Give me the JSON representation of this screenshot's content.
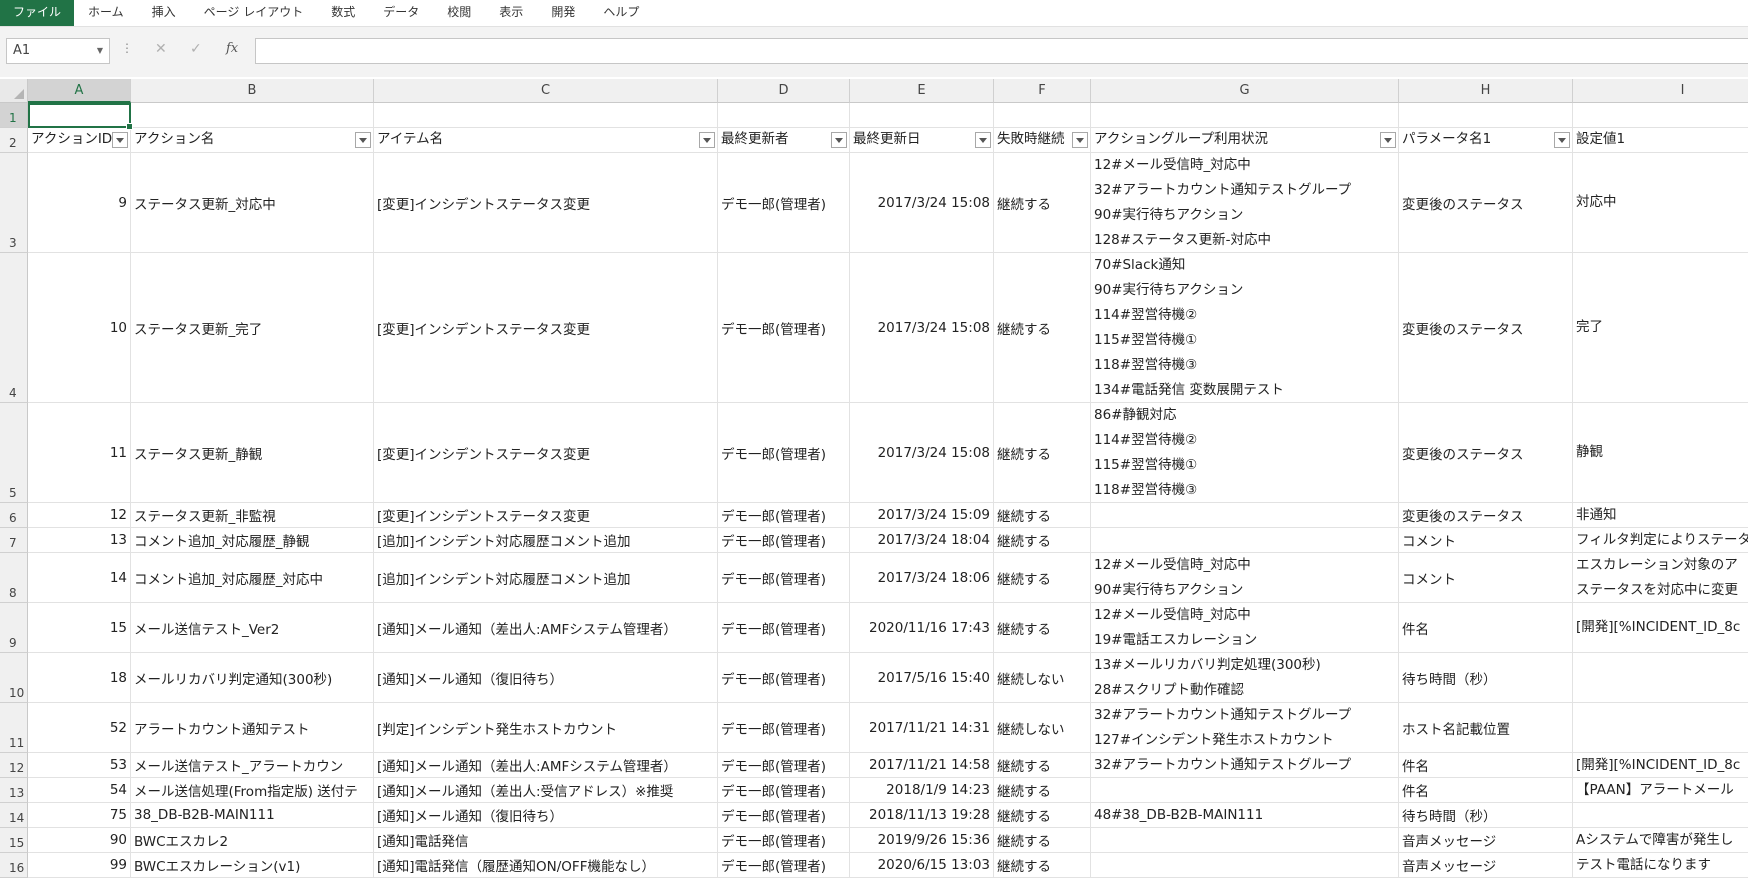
{
  "ribbon": {
    "tabs": [
      "ファイル",
      "ホーム",
      "挿入",
      "ページ レイアウト",
      "数式",
      "データ",
      "校閲",
      "表示",
      "開発",
      "ヘルプ"
    ]
  },
  "formula_bar": {
    "name_box": "A1",
    "formula": ""
  },
  "columns": [
    "A",
    "B",
    "C",
    "D",
    "E",
    "F",
    "G",
    "H",
    "I"
  ],
  "row_numbers": [
    "1",
    "2",
    "3",
    "4",
    "5",
    "6",
    "7",
    "8",
    "9",
    "10",
    "11",
    "12",
    "13",
    "14",
    "15",
    "16"
  ],
  "headers": [
    "アクションID",
    "アクション名",
    "アイテム名",
    "最終更新者",
    "最終更新日",
    "失敗時継続",
    "アクショングループ利用状況",
    "パラメータ名1",
    "設定値1"
  ],
  "rows": [
    {
      "id": "9",
      "name": "ステータス更新_対応中",
      "item": "[変更]インシデントステータス変更",
      "updater": "デモ一郎(管理者)",
      "date": "2017/3/24 15:08",
      "cont": "継続する",
      "groups": [
        "12#メール受信時_対応中",
        "32#アラートカウント通知テストグループ",
        "90#実行待ちアクション",
        "128#ステータス更新-対応中"
      ],
      "param": "変更後のステータス",
      "value": [
        "対応中"
      ]
    },
    {
      "id": "10",
      "name": "ステータス更新_完了",
      "item": "[変更]インシデントステータス変更",
      "updater": "デモ一郎(管理者)",
      "date": "2017/3/24 15:08",
      "cont": "継続する",
      "groups": [
        "70#Slack通知",
        "90#実行待ちアクション",
        "114#翌営待機②",
        "115#翌営待機①",
        "118#翌営待機③",
        "134#電話発信 変数展開テスト"
      ],
      "param": "変更後のステータス",
      "value": [
        "完了"
      ]
    },
    {
      "id": "11",
      "name": "ステータス更新_静観",
      "item": "[変更]インシデントステータス変更",
      "updater": "デモ一郎(管理者)",
      "date": "2017/3/24 15:08",
      "cont": "継続する",
      "groups": [
        "86#静観対応",
        "114#翌営待機②",
        "115#翌営待機①",
        "118#翌営待機③"
      ],
      "param": "変更後のステータス",
      "value": [
        "静観"
      ]
    },
    {
      "id": "12",
      "name": "ステータス更新_非監視",
      "item": "[変更]インシデントステータス変更",
      "updater": "デモ一郎(管理者)",
      "date": "2017/3/24 15:09",
      "cont": "継続する",
      "groups": [],
      "param": "変更後のステータス",
      "value": [
        "非通知"
      ]
    },
    {
      "id": "13",
      "name": "コメント追加_対応履歴_静観",
      "item": "[追加]インシデント対応履歴コメント追加",
      "updater": "デモ一郎(管理者)",
      "date": "2017/3/24 18:04",
      "cont": "継続する",
      "groups": [],
      "param": "コメント",
      "value": [
        "フィルタ判定によりステータ"
      ]
    },
    {
      "id": "14",
      "name": "コメント追加_対応履歴_対応中",
      "item": "[追加]インシデント対応履歴コメント追加",
      "updater": "デモ一郎(管理者)",
      "date": "2017/3/24 18:06",
      "cont": "継続する",
      "groups": [
        "12#メール受信時_対応中",
        "90#実行待ちアクション"
      ],
      "param": "コメント",
      "value": [
        "エスカレーション対象のア",
        "ステータスを対応中に変更"
      ]
    },
    {
      "id": "15",
      "name": "メール送信テスト_Ver2",
      "item": "[通知]メール通知（差出人:AMFシステム管理者）",
      "updater": "デモ一郎(管理者)",
      "date": "2020/11/16 17:43",
      "cont": "継続する",
      "groups": [
        "12#メール受信時_対応中",
        "19#電話エスカレーション"
      ],
      "param": "件名",
      "value": [
        "[開発][%INCIDENT_ID_8c"
      ]
    },
    {
      "id": "18",
      "name": "メールリカバリ判定通知(300秒)",
      "item": "[通知]メール通知（復旧待ち）",
      "updater": "デモ一郎(管理者)",
      "date": "2017/5/16 15:40",
      "cont": "継続しない",
      "groups": [
        "13#メールリカバリ判定処理(300秒)",
        "28#スクリプト動作確認"
      ],
      "param": "待ち時間（秒）",
      "value": [
        ""
      ]
    },
    {
      "id": "52",
      "name": "アラートカウント通知テスト",
      "item": "[判定]インシデント発生ホストカウント",
      "updater": "デモ一郎(管理者)",
      "date": "2017/11/21 14:31",
      "cont": "継続しない",
      "groups": [
        "32#アラートカウント通知テストグループ",
        "127#インシデント発生ホストカウント"
      ],
      "param": "ホスト名記載位置",
      "value": [
        ""
      ]
    },
    {
      "id": "53",
      "name": "メール送信テスト_アラートカウン",
      "item": "[通知]メール通知（差出人:AMFシステム管理者）",
      "updater": "デモ一郎(管理者)",
      "date": "2017/11/21 14:58",
      "cont": "継続する",
      "groups": [
        "32#アラートカウント通知テストグループ"
      ],
      "param": "件名",
      "value": [
        "[開発][%INCIDENT_ID_8c"
      ]
    },
    {
      "id": "54",
      "name": "メール送信処理(From指定版) 送付テ",
      "item": "[通知]メール通知（差出人:受信アドレス）※推奨",
      "updater": "デモ一郎(管理者)",
      "date": "2018/1/9 14:23",
      "cont": "継続する",
      "groups": [],
      "param": "件名",
      "value": [
        "【PAAN】アラートメール"
      ]
    },
    {
      "id": "75",
      "name": "38_DB-B2B-MAIN111",
      "item": "[通知]メール通知（復旧待ち）",
      "updater": "デモ一郎(管理者)",
      "date": "2018/11/13 19:28",
      "cont": "継続する",
      "groups": [
        "48#38_DB-B2B-MAIN111"
      ],
      "param": "待ち時間（秒）",
      "value": [
        ""
      ]
    },
    {
      "id": "90",
      "name": "BWCエスカレ2",
      "item": "[通知]電話発信",
      "updater": "デモ一郎(管理者)",
      "date": "2019/9/26 15:36",
      "cont": "継続する",
      "groups": [],
      "param": "音声メッセージ",
      "value": [
        "Aシステムで障害が発生し"
      ]
    },
    {
      "id": "99",
      "name": "BWCエスカレーション(v1)",
      "item": "[通知]電話発信（履歴通知ON/OFF機能なし）",
      "updater": "デモ一郎(管理者)",
      "date": "2020/6/15 13:03",
      "cont": "継続する",
      "groups": [],
      "param": "音声メッセージ",
      "value": [
        "テスト電話になります"
      ]
    }
  ]
}
